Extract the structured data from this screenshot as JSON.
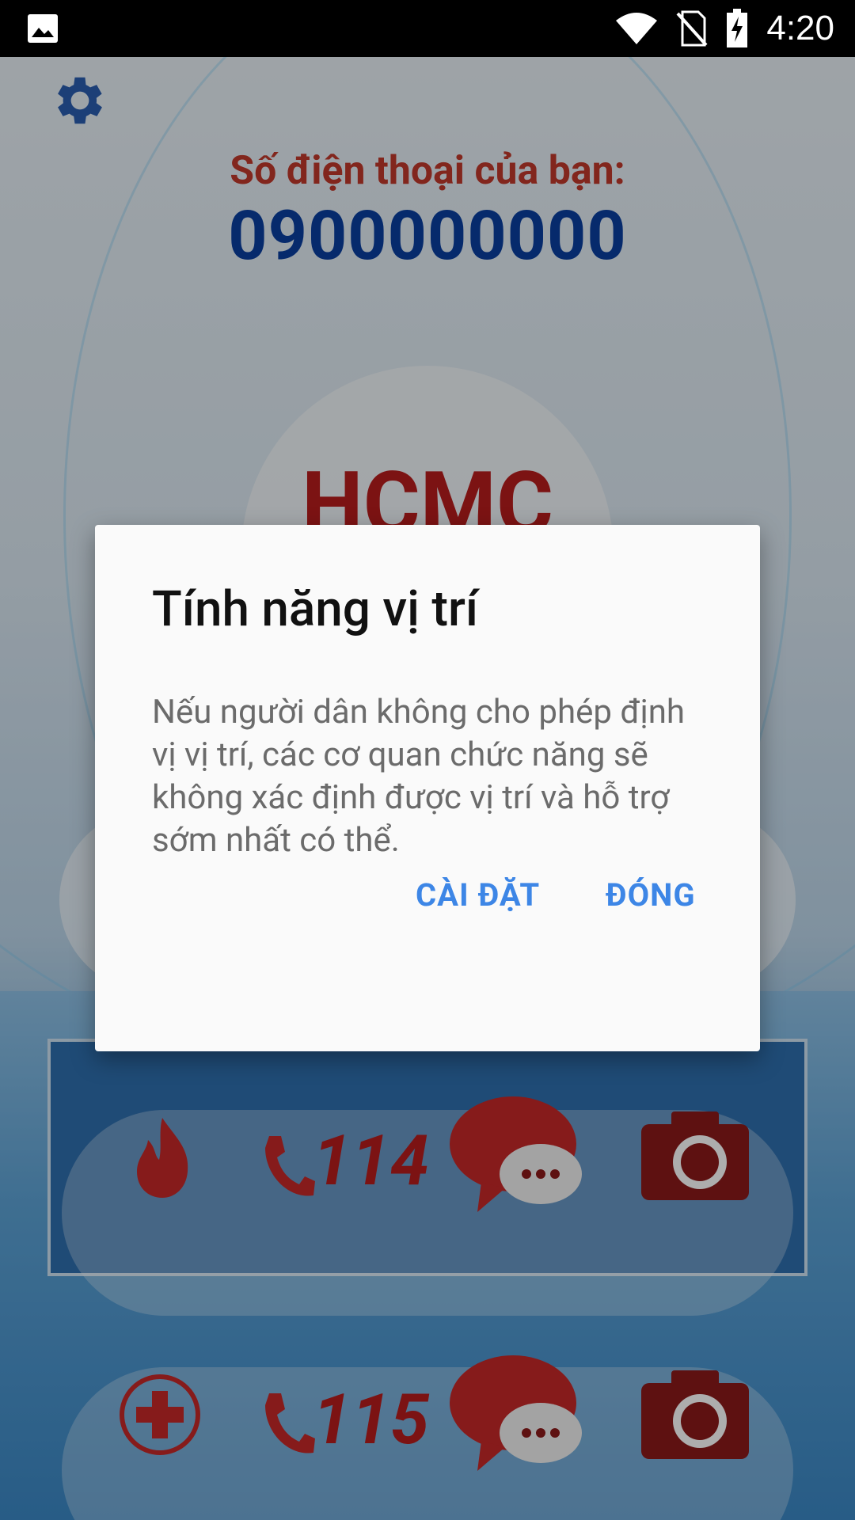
{
  "status_bar": {
    "time": "4:20",
    "icons": [
      "image-icon",
      "wifi-icon",
      "no-sim-icon",
      "battery-charging-icon"
    ]
  },
  "header": {
    "phone_label": "Số điện thoại của bạn:",
    "phone_number": "0900000000"
  },
  "logo": {
    "text": "HCMC"
  },
  "emergency": {
    "row1": {
      "number": "114",
      "icons": [
        "fire-icon",
        "phone-icon",
        "chat-icon",
        "camera-icon"
      ]
    },
    "row2": {
      "number": "115",
      "icons": [
        "medical-cross-icon",
        "phone-icon",
        "chat-icon",
        "camera-icon"
      ]
    }
  },
  "dialog": {
    "title": "Tính năng vị trí",
    "body": "Nếu người dân không cho phép định vị vị trí, các cơ quan chức năng sẽ không xác định được vị trí và hỗ trợ sớm nhất có thể.",
    "settings_label": "CÀI ĐẶT",
    "close_label": "ĐÓNG"
  },
  "colors": {
    "accent": "#3d86e6",
    "brand_red": "#b71c1c",
    "phone_blue": "#0a3fa0",
    "settings_blue": "#2a5db0"
  }
}
